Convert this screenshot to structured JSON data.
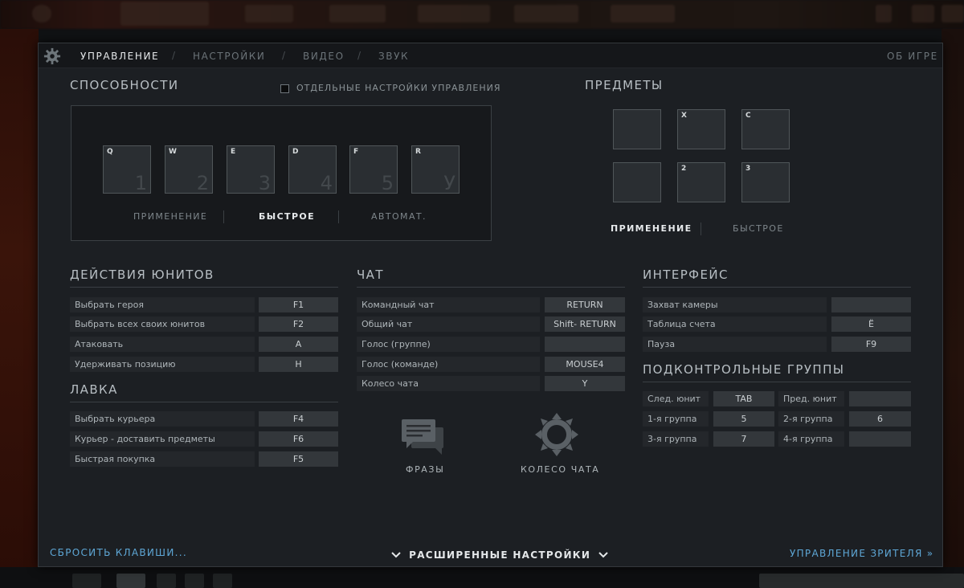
{
  "nav": {
    "tabs": [
      "УПРАВЛЕНИЕ",
      "НАСТРОЙКИ",
      "ВИДЕО",
      "ЗВУК"
    ],
    "separator": "/",
    "about": "ОБ ИГРЕ"
  },
  "abilities": {
    "title": "СПОСОБНОСТИ",
    "checkbox_label": "ОТДЕЛЬНЫЕ НАСТРОЙКИ УПРАВЛЕНИЯ",
    "slots": [
      {
        "key": "Q",
        "num": "1"
      },
      {
        "key": "W",
        "num": "2"
      },
      {
        "key": "E",
        "num": "3"
      },
      {
        "key": "D",
        "num": "4"
      },
      {
        "key": "F",
        "num": "5"
      },
      {
        "key": "R",
        "num": "У"
      }
    ],
    "modes": [
      "ПРИМЕНЕНИЕ",
      "БЫСТРОЕ",
      "АВТОМАТ."
    ],
    "active_mode": "БЫСТРОЕ"
  },
  "items": {
    "title": "ПРЕДМЕТЫ",
    "slots": [
      "",
      "X",
      "C",
      "",
      "2",
      "3"
    ],
    "modes": [
      "ПРИМЕНЕНИЕ",
      "БЫСТРОЕ"
    ],
    "active_mode": "ПРИМЕНЕНИЕ"
  },
  "unit_actions": {
    "title": "ДЕЙСТВИЯ ЮНИТОВ",
    "rows": [
      {
        "label": "Выбрать героя",
        "key": "F1"
      },
      {
        "label": "Выбрать всех своих юнитов",
        "key": "F2"
      },
      {
        "label": "Атаковать",
        "key": "A"
      },
      {
        "label": "Удерживать позицию",
        "key": "H"
      }
    ]
  },
  "shop": {
    "title": "ЛАВКА",
    "rows": [
      {
        "label": "Выбрать курьера",
        "key": "F4"
      },
      {
        "label": "Курьер - доставить предметы",
        "key": "F6"
      },
      {
        "label": "Быстрая покупка",
        "key": "F5"
      }
    ]
  },
  "chat": {
    "title": "ЧАТ",
    "rows": [
      {
        "label": "Командный чат",
        "key": "RETURN"
      },
      {
        "label": "Общий чат",
        "key": "Shift- RETURN"
      },
      {
        "label": "Голос (группе)",
        "key": ""
      },
      {
        "label": "Голос (команде)",
        "key": "MOUSE4"
      },
      {
        "label": "Колесо чата",
        "key": "Y"
      }
    ],
    "phrases_label": "ФРАЗЫ",
    "wheel_label": "КОЛЕСО ЧАТА"
  },
  "interface": {
    "title": "ИНТЕРФЕЙС",
    "rows": [
      {
        "label": "Захват камеры",
        "key": ""
      },
      {
        "label": "Таблица счета",
        "key": "Ё"
      },
      {
        "label": "Пауза",
        "key": "F9"
      }
    ]
  },
  "control_groups": {
    "title": "ПОДКОНТРОЛЬНЫЕ ГРУППЫ",
    "rows": [
      {
        "l1": "След. юнит",
        "k1": "TAB",
        "l2": "Пред. юнит",
        "k2": ""
      },
      {
        "l1": "1-я группа",
        "k1": "5",
        "l2": "2-я группа",
        "k2": "6"
      },
      {
        "l1": "3-я группа",
        "k1": "7",
        "l2": "4-я группа",
        "k2": ""
      }
    ]
  },
  "footer": {
    "reset": "СБРОСИТЬ КЛАВИШИ...",
    "advanced": "РАСШИРЕННЫЕ НАСТРОЙКИ",
    "spectator": "УПРАВЛЕНИЕ ЗРИТЕЛЯ »"
  },
  "colors": {
    "accent_link": "#5ea7d6",
    "panel_bg": "#1c1f23"
  }
}
